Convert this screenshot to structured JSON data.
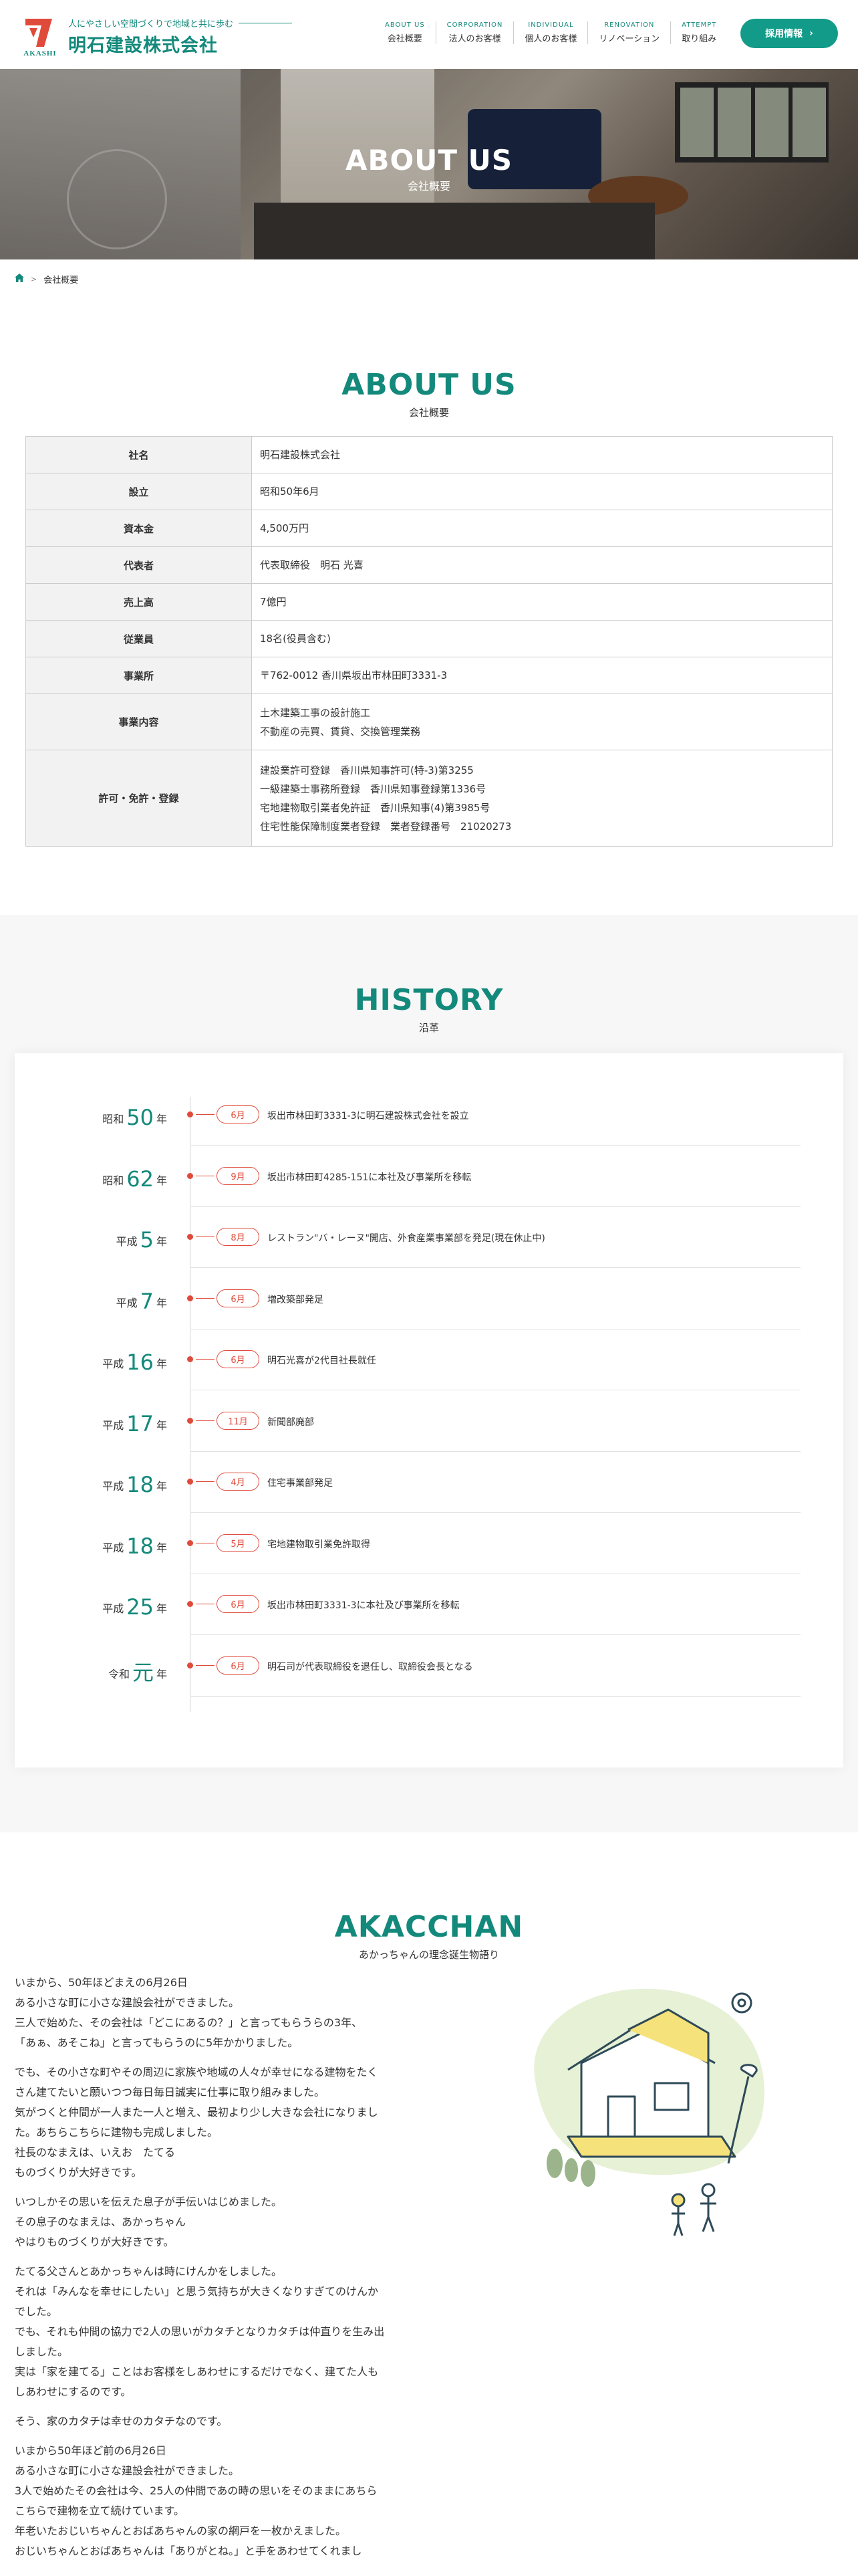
{
  "header": {
    "tagline": "人にやさしい空間づくりで地域と共に歩む",
    "company_name": "明石建設株式会社",
    "logo_mark_text": "AKASHI",
    "nav": [
      {
        "en": "ABOUT US",
        "ja": "会社概要"
      },
      {
        "en": "CORPORATION",
        "ja": "法人のお客様"
      },
      {
        "en": "INDIVIDUAL",
        "ja": "個人のお客様"
      },
      {
        "en": "RENOVATION",
        "ja": "リノベーション"
      },
      {
        "en": "ATTEMPT",
        "ja": "取り組み"
      }
    ],
    "recruit_label": "採用情報",
    "recruit_arrow": "›"
  },
  "hero": {
    "title": "ABOUT US",
    "subtitle": "会社概要"
  },
  "breadcrumb": {
    "home_icon": "home-icon",
    "separator": ">",
    "current": "会社概要"
  },
  "about": {
    "title": "ABOUT US",
    "subtitle": "会社概要",
    "rows": [
      {
        "label": "社名",
        "lines": [
          "明石建設株式会社"
        ]
      },
      {
        "label": "設立",
        "lines": [
          "昭和50年6月"
        ]
      },
      {
        "label": "資本金",
        "lines": [
          "4,500万円"
        ]
      },
      {
        "label": "代表者",
        "lines": [
          "代表取締役　明石 光喜"
        ]
      },
      {
        "label": "売上高",
        "lines": [
          "7億円"
        ]
      },
      {
        "label": "従業員",
        "lines": [
          "18名(役員含む)"
        ]
      },
      {
        "label": "事業所",
        "lines": [
          "〒762-0012 香川県坂出市林田町3331-3"
        ]
      },
      {
        "label": "事業内容",
        "lines": [
          "土木建築工事の設計施工",
          "不動産の売買、賃貸、交換管理業務"
        ]
      },
      {
        "label": "許可・免許・登録",
        "lines": [
          "建設業許可登録　香川県知事許可(特-3)第3255",
          "一級建築士事務所登録　香川県知事登録第1336号",
          "宅地建物取引業者免許証　香川県知事(4)第3985号",
          "住宅性能保障制度業者登録　業者登録番号　21020273"
        ]
      }
    ]
  },
  "history": {
    "title": "HISTORY",
    "subtitle": "沿革",
    "year_suffix": "年",
    "items": [
      {
        "era": "昭和",
        "year": "50",
        "month": "6月",
        "event": "坂出市林田町3331-3に明石建設株式会社を設立"
      },
      {
        "era": "昭和",
        "year": "62",
        "month": "9月",
        "event": "坂出市林田町4285-151に本社及び事業所を移転"
      },
      {
        "era": "平成",
        "year": "5",
        "month": "8月",
        "event": "レストラン\"バ・レーヌ\"開店、外食産業事業部を発足(現在休止中)"
      },
      {
        "era": "平成",
        "year": "7",
        "month": "6月",
        "event": "増改築部発足"
      },
      {
        "era": "平成",
        "year": "16",
        "month": "6月",
        "event": "明石光喜が2代目社長就任"
      },
      {
        "era": "平成",
        "year": "17",
        "month": "11月",
        "event": "新聞部廃部"
      },
      {
        "era": "平成",
        "year": "18",
        "month": "4月",
        "event": "住宅事業部発足"
      },
      {
        "era": "平成",
        "year": "18",
        "month": "5月",
        "event": "宅地建物取引業免許取得"
      },
      {
        "era": "平成",
        "year": "25",
        "month": "6月",
        "event": "坂出市林田町3331-3に本社及び事業所を移転"
      },
      {
        "era": "令和",
        "year": "元",
        "month": "6月",
        "event": "明石司が代表取締役を退任し、取締役会長となる"
      }
    ]
  },
  "akacchan": {
    "title": "AKACCHAN",
    "subtitle": "あかっちゃんの理念誕生物語り",
    "paragraphs": [
      [
        "いまから、50年ほどまえの6月26日",
        "ある小さな町に小さな建設会社ができました。",
        "三人で始めた、その会社は「どこにあるの？」と言ってもらうらの3年、",
        "「あぁ、あそこね」と言ってもらうのに5年かかりました。"
      ],
      [
        "でも、その小さな町やその周辺に家族や地域の人々が幸せになる建物をたく",
        "さん建てたいと願いつつ毎日毎日誠実に仕事に取り組みました。",
        "気がつくと仲間が一人また一人と増え、最初より少し大きな会社になりまし",
        "た。あちらこちらに建物も完成しました。",
        "社長のなまえは、いえお　たてる",
        "ものづくりが大好きです。"
      ],
      [
        "いつしかその思いを伝えた息子が手伝いはじめました。",
        "その息子のなまえは、あかっちゃん",
        "やはりものづくりが大好きです。"
      ],
      [
        "たてる父さんとあかっちゃんは時にけんかをしました。",
        "それは「みんなを幸せにしたい」と思う気持ちが大きくなりすぎてのけんか",
        "でした。",
        "でも、それも仲間の協力で2人の思いがカタチとなりカタチは仲直りを生み出",
        "しました。",
        "実は「家を建てる」ことはお客様をしあわせにするだけでなく、建てた人も",
        "しあわせにするのです。"
      ],
      [
        "そう、家のカタチは幸せのカタチなのです。"
      ],
      [
        "いまから50年ほど前の6月26日",
        "ある小さな町に小さな建設会社ができました。",
        "3人で始めたその会社は今、25人の仲間であの時の思いをそのままにあちら",
        "こちらで建物を立て続けています。",
        "年老いたおじいちゃんとおばあちゃんの家の網戸を一枚かえました。",
        "おじいちゃんとおばあちゃんは「ありがとね。」と手をあわせてくれまし"
      ]
    ]
  },
  "colors": {
    "brand_green": "#13897b",
    "accent_red": "#e04a3a",
    "section_gray": "#f7f7f7"
  }
}
